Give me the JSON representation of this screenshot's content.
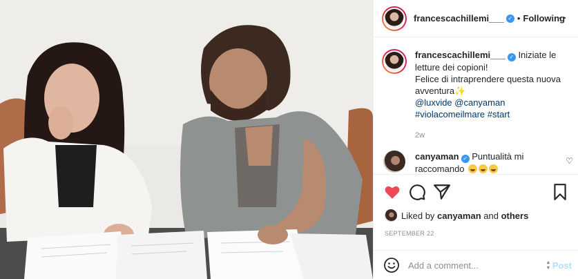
{
  "header": {
    "username": "francescachillemi___",
    "separator": "•",
    "follow_status": "Following",
    "more_icon": "more-options-icon"
  },
  "caption": {
    "username": "francescachillemi___",
    "line1": "Iniziate le letture dei copioni!",
    "line2": "Felice di intraprendere questa nuova avventura",
    "tags": "@luxvide @canyaman #violacomeilmare #start",
    "time_ago": "2w"
  },
  "comment": {
    "username": "canyaman",
    "text": "Puntualità mi raccomando"
  },
  "likes": {
    "prefix": "Liked by",
    "user": "canyaman",
    "conjunction": "and",
    "others": "others"
  },
  "date": "SEPTEMBER 22",
  "add_comment": {
    "placeholder": "Add a comment...",
    "post_label": "Post"
  },
  "colors": {
    "like_red": "#ed4956",
    "verified_blue": "#3897f0",
    "post_button_disabled": "#b2dffc",
    "tag_link": "#00376b"
  }
}
